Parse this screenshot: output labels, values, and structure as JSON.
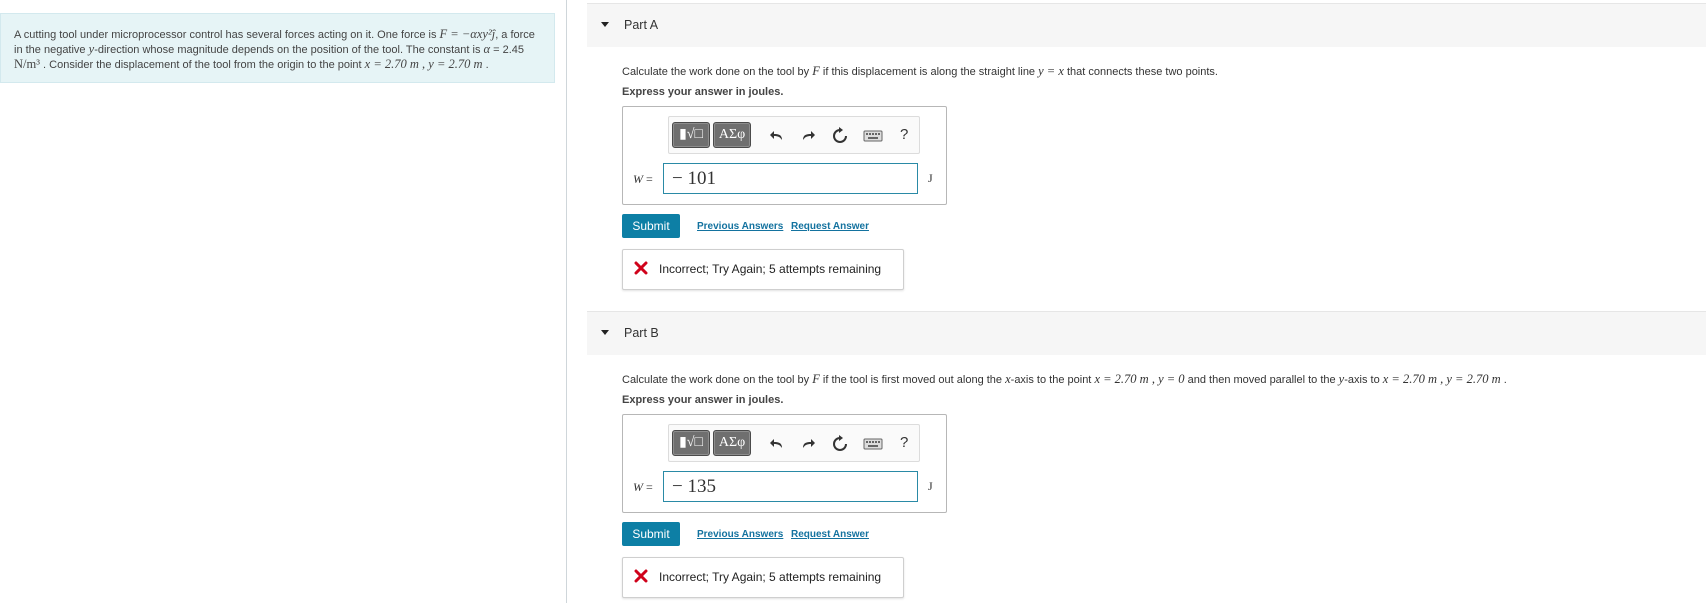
{
  "problem": {
    "text_1": "A cutting tool under microprocessor control has several forces acting on it. One force is ",
    "formula_F": "F = −αxy²ĵ",
    "text_2": ", a force",
    "text_3": "in the negative ",
    "y_var": "y",
    "text_4": "-direction whose magnitude depends on the position of the tool. The constant is ",
    "alpha_sym": "α",
    "alpha_value": " = 2.45",
    "alpha_units": "N/m³",
    "text_5": " . Consider the displacement of the tool from the origin to the point ",
    "point": "x = 2.70 m , y = 2.70 m",
    "text_6": " ."
  },
  "parts": [
    {
      "title": "Part A",
      "question_1": "Calculate the work done on the tool by ",
      "question_F": "F",
      "question_2": " if this displacement is along the straight line ",
      "question_math": "y = x",
      "question_3": " that connects these two points.",
      "express": "Express your answer in joules.",
      "variable": "W",
      "equals": "=",
      "answer_value": "− 101",
      "unit": "J",
      "submit_label": "Submit",
      "previous_answers_label": "Previous Answers",
      "request_answer_label": "Request Answer",
      "feedback": "Incorrect; Try Again; 5 attempts remaining"
    },
    {
      "title": "Part B",
      "question_1": "Calculate the work done on the tool by ",
      "question_F": "F",
      "question_2": " if the tool is first moved out along the ",
      "question_x": "x",
      "question_3": "-axis to the point ",
      "question_p1": "x = 2.70 m , y = 0",
      "question_4": " and then moved parallel to the ",
      "question_y": "y",
      "question_5": "-axis to ",
      "question_p2": "x = 2.70 m , y = 2.70 m",
      "question_6": " .",
      "express": "Express your answer in joules.",
      "variable": "W",
      "equals": "=",
      "answer_value": "− 135",
      "unit": "J",
      "submit_label": "Submit",
      "previous_answers_label": "Previous Answers",
      "request_answer_label": "Request Answer",
      "feedback": "Incorrect; Try Again; 5 attempts remaining"
    }
  ],
  "toolbar": {
    "template_label": "▮√□",
    "symbols_label": "ΑΣφ",
    "help_label": "?",
    "icons": [
      "undo-icon",
      "redo-icon",
      "reset-icon",
      "keyboard-icon"
    ]
  },
  "colors": {
    "submit_bg": "#0d7fa5",
    "link": "#13729f",
    "error_x": "#d0021b",
    "problem_bg": "#e6f4f6"
  }
}
